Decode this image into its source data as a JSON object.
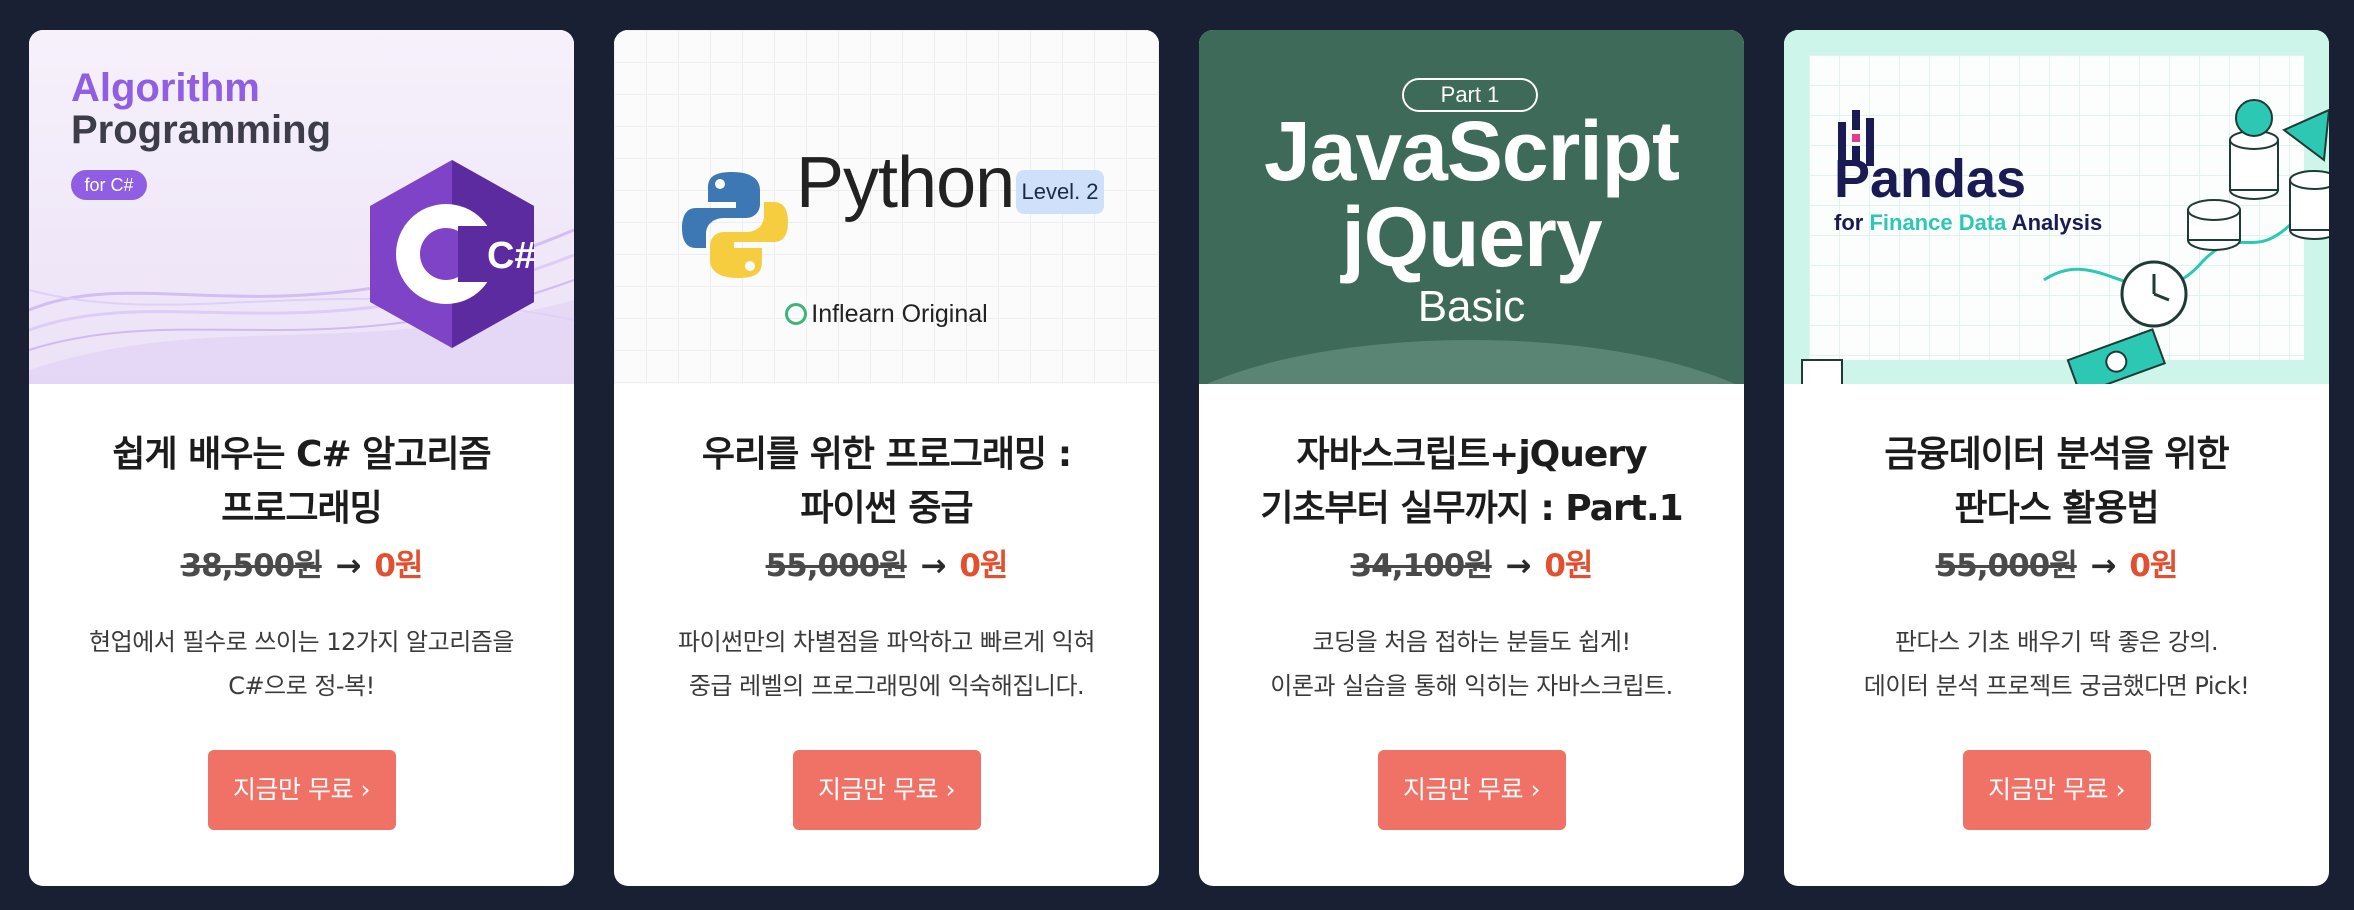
{
  "colors": {
    "background": "#1a2033",
    "card": "#ffffff",
    "button": "#f07266",
    "price_new": "#e2502f"
  },
  "cards": [
    {
      "thumb": {
        "line1": "Algorithm",
        "line2": "Programming",
        "badge": "for C#",
        "logo_text": "C#",
        "icon": "csharp-hexagon-icon"
      },
      "title_line1": "쉽게 배우는 C# 알고리즘",
      "title_line2": "프로그래밍",
      "price_old": "38,500원",
      "price_arrow": "→",
      "price_new": "0원",
      "desc_line1": "현업에서 필수로 쓰이는 12가지 알고리즘을",
      "desc_line2": "C#으로 정-복!",
      "button": "지금만 무료 ›"
    },
    {
      "thumb": {
        "word": "Python",
        "level": "Level. 2",
        "original": "Inflearn Original",
        "icon": "python-logo-icon"
      },
      "title_line1": "우리를 위한 프로그래밍 :",
      "title_line2": "파이썬 중급",
      "price_old": "55,000원",
      "price_arrow": "→",
      "price_new": "0원",
      "desc_line1": "파이썬만의 차별점을 파악하고 빠르게 익혀",
      "desc_line2": "중급 레벨의 프로그래밍에 익숙해집니다.",
      "button": "지금만 무료 ›"
    },
    {
      "thumb": {
        "part": "Part 1",
        "line1": "JavaScript",
        "line2": "jQuery",
        "line3": "Basic"
      },
      "title_line1": "자바스크립트+jQuery",
      "title_line2": "기초부터 실무까지 : Part.1",
      "price_old": "34,100원",
      "price_arrow": "→",
      "price_new": "0원",
      "desc_line1": "코딩을 처음 접하는 분들도 쉽게!",
      "desc_line2": "이론과 실습을 통해 익히는 자바스크립트.",
      "button": "지금만 무료 ›"
    },
    {
      "thumb": {
        "word": "Pandas",
        "sub_for": "for ",
        "sub_hl": "Finance Data",
        "sub_rest": " Analysis",
        "icon": "pandas-logo-icon"
      },
      "title_line1": "금융데이터 분석을 위한",
      "title_line2": "판다스 활용법",
      "price_old": "55,000원",
      "price_arrow": "→",
      "price_new": "0원",
      "desc_line1": "판다스 기초 배우기 딱 좋은 강의.",
      "desc_line2": "데이터 분석 프로젝트 궁금했다면 Pick!",
      "button": "지금만 무료 ›"
    }
  ]
}
